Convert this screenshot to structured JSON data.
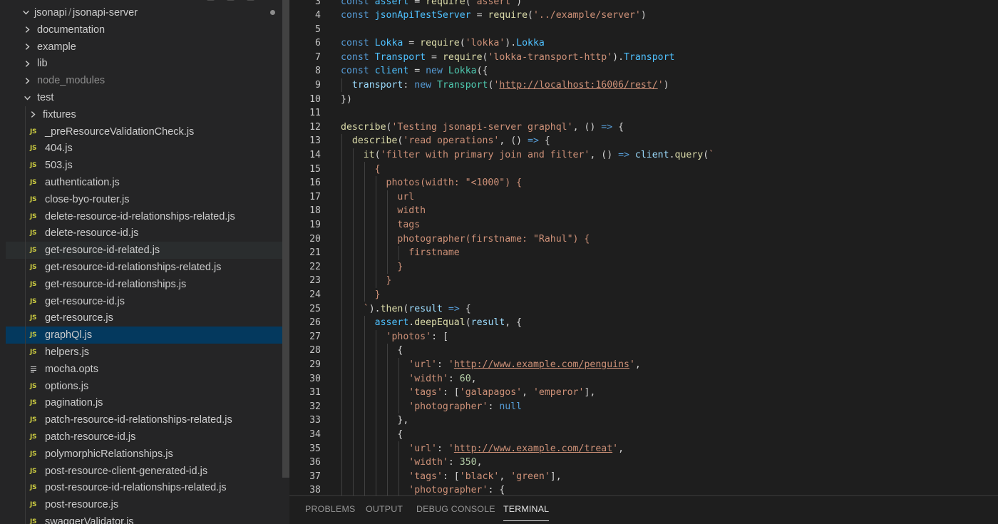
{
  "explorer": {
    "root_label_org": "jsonapi",
    "root_separator": "/",
    "root_label_repo": "jsonapi-server",
    "items": [
      {
        "label": "documentation",
        "kind": "folder",
        "state": "collapsed",
        "depth": 1
      },
      {
        "label": "example",
        "kind": "folder",
        "state": "collapsed",
        "depth": 1
      },
      {
        "label": "lib",
        "kind": "folder",
        "state": "collapsed",
        "depth": 1
      },
      {
        "label": "node_modules",
        "kind": "folder",
        "state": "collapsed",
        "depth": 1,
        "dimmed": true
      },
      {
        "label": "test",
        "kind": "folder",
        "state": "expanded",
        "depth": 1
      },
      {
        "label": "fixtures",
        "kind": "folder",
        "state": "collapsed",
        "depth": 2
      },
      {
        "label": "_preResourceValidationCheck.js",
        "kind": "js",
        "depth": 2
      },
      {
        "label": "404.js",
        "kind": "js",
        "depth": 2
      },
      {
        "label": "503.js",
        "kind": "js",
        "depth": 2
      },
      {
        "label": "authentication.js",
        "kind": "js",
        "depth": 2
      },
      {
        "label": "close-byo-router.js",
        "kind": "js",
        "depth": 2
      },
      {
        "label": "delete-resource-id-relationships-related.js",
        "kind": "js",
        "depth": 2
      },
      {
        "label": "delete-resource-id.js",
        "kind": "js",
        "depth": 2
      },
      {
        "label": "get-resource-id-related.js",
        "kind": "js",
        "depth": 2,
        "hovered": true
      },
      {
        "label": "get-resource-id-relationships-related.js",
        "kind": "js",
        "depth": 2
      },
      {
        "label": "get-resource-id-relationships.js",
        "kind": "js",
        "depth": 2
      },
      {
        "label": "get-resource-id.js",
        "kind": "js",
        "depth": 2
      },
      {
        "label": "get-resource.js",
        "kind": "js",
        "depth": 2
      },
      {
        "label": "graphQl.js",
        "kind": "js",
        "depth": 2,
        "selected": true
      },
      {
        "label": "helpers.js",
        "kind": "js",
        "depth": 2
      },
      {
        "label": "mocha.opts",
        "kind": "opts",
        "depth": 2
      },
      {
        "label": "options.js",
        "kind": "js",
        "depth": 2
      },
      {
        "label": "pagination.js",
        "kind": "js",
        "depth": 2
      },
      {
        "label": "patch-resource-id-relationships-related.js",
        "kind": "js",
        "depth": 2
      },
      {
        "label": "patch-resource-id.js",
        "kind": "js",
        "depth": 2
      },
      {
        "label": "polymorphicRelationships.js",
        "kind": "js",
        "depth": 2
      },
      {
        "label": "post-resource-client-generated-id.js",
        "kind": "js",
        "depth": 2
      },
      {
        "label": "post-resource-id-relationships-related.js",
        "kind": "js",
        "depth": 2
      },
      {
        "label": "post-resource.js",
        "kind": "js",
        "depth": 2
      },
      {
        "label": "swaggerValidator.js",
        "kind": "js",
        "depth": 2
      }
    ],
    "js_badge": "JS"
  },
  "editor": {
    "lines": [
      {
        "n": "3",
        "indent": 0,
        "t": [
          [
            "kw",
            "const "
          ],
          [
            "v",
            "assert"
          ],
          [
            "p",
            " = "
          ],
          [
            "fn",
            "require"
          ],
          [
            "p",
            "("
          ],
          [
            "s",
            "'assert'"
          ],
          [
            "p",
            ")"
          ]
        ]
      },
      {
        "n": "4",
        "indent": 0,
        "t": [
          [
            "kw",
            "const "
          ],
          [
            "v",
            "jsonApiTestServer"
          ],
          [
            "p",
            " = "
          ],
          [
            "fn",
            "require"
          ],
          [
            "p",
            "("
          ],
          [
            "s",
            "'../example/server'"
          ],
          [
            "p",
            ")"
          ]
        ]
      },
      {
        "n": "5",
        "indent": 0,
        "t": []
      },
      {
        "n": "6",
        "indent": 0,
        "t": [
          [
            "kw",
            "const "
          ],
          [
            "v",
            "Lokka"
          ],
          [
            "p",
            " = "
          ],
          [
            "fn",
            "require"
          ],
          [
            "p",
            "("
          ],
          [
            "s",
            "'lokka'"
          ],
          [
            "p",
            ")."
          ],
          [
            "v",
            "Lokka"
          ]
        ]
      },
      {
        "n": "7",
        "indent": 0,
        "t": [
          [
            "kw",
            "const "
          ],
          [
            "v",
            "Transport"
          ],
          [
            "p",
            " = "
          ],
          [
            "fn",
            "require"
          ],
          [
            "p",
            "("
          ],
          [
            "s",
            "'lokka-transport-http'"
          ],
          [
            "p",
            ")."
          ],
          [
            "v",
            "Transport"
          ]
        ]
      },
      {
        "n": "8",
        "indent": 0,
        "t": [
          [
            "kw",
            "const "
          ],
          [
            "v",
            "client"
          ],
          [
            "p",
            " = "
          ],
          [
            "kw",
            "new "
          ],
          [
            "cls",
            "Lokka"
          ],
          [
            "p",
            "({"
          ]
        ]
      },
      {
        "n": "9",
        "indent": 1,
        "t": [
          [
            "p",
            "  "
          ],
          [
            "prop",
            "transport"
          ],
          [
            "p",
            ": "
          ],
          [
            "kw",
            "new "
          ],
          [
            "cls",
            "Transport"
          ],
          [
            "p",
            "("
          ],
          [
            "s",
            "'"
          ],
          [
            "su",
            "http://localhost:16006/rest/"
          ],
          [
            "s",
            "'"
          ],
          [
            "p",
            ")"
          ]
        ]
      },
      {
        "n": "10",
        "indent": 0,
        "t": [
          [
            "p",
            "})"
          ]
        ]
      },
      {
        "n": "11",
        "indent": 0,
        "t": []
      },
      {
        "n": "12",
        "indent": 0,
        "t": [
          [
            "fn",
            "describe"
          ],
          [
            "p",
            "("
          ],
          [
            "s",
            "'Testing jsonapi-server graphql'"
          ],
          [
            "p",
            ", () "
          ],
          [
            "kw",
            "=>"
          ],
          [
            "p",
            " {"
          ]
        ]
      },
      {
        "n": "13",
        "indent": 1,
        "t": [
          [
            "p",
            "  "
          ],
          [
            "fn",
            "describe"
          ],
          [
            "p",
            "("
          ],
          [
            "s",
            "'read operations'"
          ],
          [
            "p",
            ", () "
          ],
          [
            "kw",
            "=>"
          ],
          [
            "p",
            " {"
          ]
        ]
      },
      {
        "n": "14",
        "indent": 2,
        "t": [
          [
            "p",
            "    "
          ],
          [
            "fn",
            "it"
          ],
          [
            "p",
            "("
          ],
          [
            "s",
            "'filter with primary join and filter'"
          ],
          [
            "p",
            ", () "
          ],
          [
            "kw",
            "=>"
          ],
          [
            "p",
            " "
          ],
          [
            "prop",
            "client"
          ],
          [
            "p",
            "."
          ],
          [
            "fn",
            "query"
          ],
          [
            "p",
            "("
          ],
          [
            "s",
            "`"
          ]
        ]
      },
      {
        "n": "15",
        "indent": 3,
        "t": [
          [
            "s",
            "      {"
          ]
        ]
      },
      {
        "n": "16",
        "indent": 4,
        "t": [
          [
            "s",
            "        photos(width: \"<1000\") {"
          ]
        ]
      },
      {
        "n": "17",
        "indent": 5,
        "t": [
          [
            "s",
            "          url"
          ]
        ]
      },
      {
        "n": "18",
        "indent": 5,
        "t": [
          [
            "s",
            "          width"
          ]
        ]
      },
      {
        "n": "19",
        "indent": 5,
        "t": [
          [
            "s",
            "          tags"
          ]
        ]
      },
      {
        "n": "20",
        "indent": 5,
        "t": [
          [
            "s",
            "          photographer(firstname: \"Rahul\") {"
          ]
        ]
      },
      {
        "n": "21",
        "indent": 6,
        "t": [
          [
            "s",
            "            firstname"
          ]
        ]
      },
      {
        "n": "22",
        "indent": 5,
        "t": [
          [
            "s",
            "          }"
          ]
        ]
      },
      {
        "n": "23",
        "indent": 4,
        "t": [
          [
            "s",
            "        }"
          ]
        ]
      },
      {
        "n": "24",
        "indent": 3,
        "t": [
          [
            "s",
            "      }"
          ]
        ]
      },
      {
        "n": "25",
        "indent": 2,
        "t": [
          [
            "s",
            "    `"
          ],
          [
            "p",
            ")."
          ],
          [
            "fn",
            "then"
          ],
          [
            "p",
            "("
          ],
          [
            "prop",
            "result"
          ],
          [
            "p",
            " "
          ],
          [
            "kw",
            "=>"
          ],
          [
            "p",
            " {"
          ]
        ]
      },
      {
        "n": "26",
        "indent": 3,
        "t": [
          [
            "p",
            "      "
          ],
          [
            "v",
            "assert"
          ],
          [
            "p",
            "."
          ],
          [
            "fn",
            "deepEqual"
          ],
          [
            "p",
            "("
          ],
          [
            "prop",
            "result"
          ],
          [
            "p",
            ", {"
          ]
        ]
      },
      {
        "n": "27",
        "indent": 4,
        "t": [
          [
            "p",
            "        "
          ],
          [
            "s",
            "'photos'"
          ],
          [
            "p",
            ": ["
          ]
        ]
      },
      {
        "n": "28",
        "indent": 5,
        "t": [
          [
            "p",
            "          {"
          ]
        ]
      },
      {
        "n": "29",
        "indent": 6,
        "t": [
          [
            "p",
            "            "
          ],
          [
            "s",
            "'url'"
          ],
          [
            "p",
            ": "
          ],
          [
            "s",
            "'"
          ],
          [
            "su",
            "http://www.example.com/penguins"
          ],
          [
            "s",
            "'"
          ],
          [
            "p",
            ","
          ]
        ]
      },
      {
        "n": "30",
        "indent": 6,
        "t": [
          [
            "p",
            "            "
          ],
          [
            "s",
            "'width'"
          ],
          [
            "p",
            ": "
          ],
          [
            "n",
            "60"
          ],
          [
            "p",
            ","
          ]
        ]
      },
      {
        "n": "31",
        "indent": 6,
        "t": [
          [
            "p",
            "            "
          ],
          [
            "s",
            "'tags'"
          ],
          [
            "p",
            ": ["
          ],
          [
            "s",
            "'galapagos'"
          ],
          [
            "p",
            ", "
          ],
          [
            "s",
            "'emperor'"
          ],
          [
            "p",
            "],"
          ]
        ]
      },
      {
        "n": "32",
        "indent": 6,
        "t": [
          [
            "p",
            "            "
          ],
          [
            "s",
            "'photographer'"
          ],
          [
            "p",
            ": "
          ],
          [
            "kw",
            "null"
          ]
        ]
      },
      {
        "n": "33",
        "indent": 5,
        "t": [
          [
            "p",
            "          },"
          ]
        ]
      },
      {
        "n": "34",
        "indent": 5,
        "t": [
          [
            "p",
            "          {"
          ]
        ]
      },
      {
        "n": "35",
        "indent": 6,
        "t": [
          [
            "p",
            "            "
          ],
          [
            "s",
            "'url'"
          ],
          [
            "p",
            ": "
          ],
          [
            "s",
            "'"
          ],
          [
            "su",
            "http://www.example.com/treat"
          ],
          [
            "s",
            "'"
          ],
          [
            "p",
            ","
          ]
        ]
      },
      {
        "n": "36",
        "indent": 6,
        "t": [
          [
            "p",
            "            "
          ],
          [
            "s",
            "'width'"
          ],
          [
            "p",
            ": "
          ],
          [
            "n",
            "350"
          ],
          [
            "p",
            ","
          ]
        ]
      },
      {
        "n": "37",
        "indent": 6,
        "t": [
          [
            "p",
            "            "
          ],
          [
            "s",
            "'tags'"
          ],
          [
            "p",
            ": ["
          ],
          [
            "s",
            "'black'"
          ],
          [
            "p",
            ", "
          ],
          [
            "s",
            "'green'"
          ],
          [
            "p",
            "],"
          ]
        ]
      },
      {
        "n": "38",
        "indent": 6,
        "t": [
          [
            "p",
            "            "
          ],
          [
            "s",
            "'photographer'"
          ],
          [
            "p",
            ": {"
          ]
        ]
      }
    ]
  },
  "panel": {
    "tabs": [
      {
        "label": "PROBLEMS",
        "active": false
      },
      {
        "label": "OUTPUT",
        "active": false
      },
      {
        "label": "DEBUG CONSOLE",
        "active": false
      },
      {
        "label": "TERMINAL",
        "active": true
      }
    ]
  },
  "colors": {
    "sidebar_bg": "#252526",
    "editor_bg": "#1e1e1e",
    "selection": "#04395e",
    "keyword": "#569cd6",
    "string": "#ce9178",
    "function": "#dcdcaa",
    "number": "#b5cea8",
    "js_icon": "#cbcb41"
  }
}
